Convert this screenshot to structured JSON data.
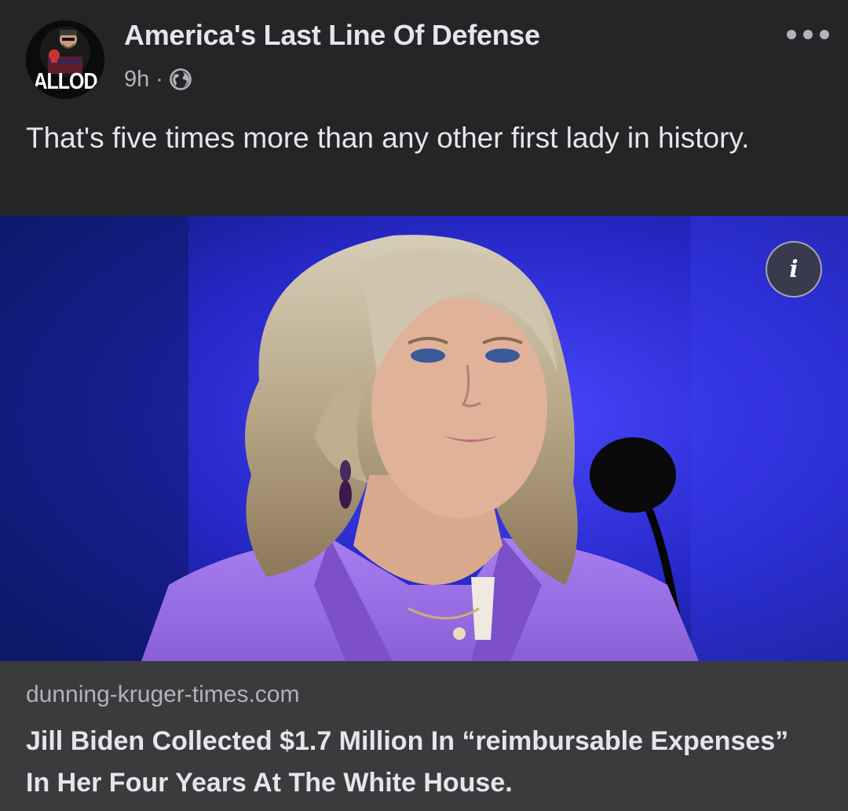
{
  "post": {
    "page_name": "America's Last Line Of Defense",
    "avatar_text": "ALLOD",
    "time": "9h",
    "separator": "·",
    "privacy_icon": "globe-icon",
    "more_icon": "more-options-icon",
    "caption": "That's five times more than any other first lady in history."
  },
  "media": {
    "info_icon": "info-icon",
    "info_label": "i"
  },
  "link_preview": {
    "domain": "dunning-kruger-times.com",
    "title": "Jill Biden Collected $1.7 Million In “reimbursable Expenses” In Her Four Years At The White House."
  },
  "colors": {
    "background": "#242526",
    "card": "#3a3b3c",
    "text_primary": "#e4e6eb",
    "text_secondary": "#b0b3b8",
    "photo_backdrop": "#2a2ee0",
    "jacket": "#9a6fe0"
  }
}
